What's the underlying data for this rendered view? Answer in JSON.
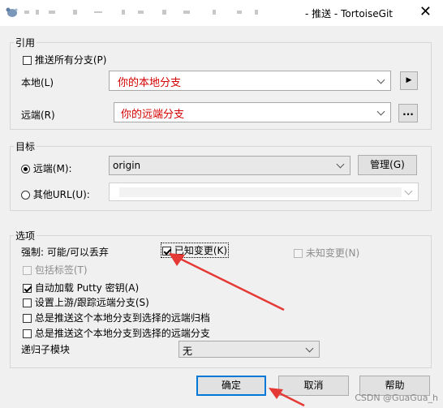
{
  "window": {
    "title": "- 推送 - TortoiseGit",
    "close_glyph": "✕"
  },
  "ref_group": {
    "legend": "引用",
    "push_all_label": "推送所有分支(P)",
    "local_label": "本地(L)",
    "local_value": "你的本地分支",
    "remote_label": "远端(R)",
    "remote_value": "你的远端分支",
    "browse_label": "...",
    "arrow_glyph": "▶"
  },
  "dest_group": {
    "legend": "目标",
    "remote_radio_label": "远端(M):",
    "remote_value": "origin",
    "manage_label": "管理(G)",
    "other_url_label": "其他URL(U):"
  },
  "options_group": {
    "legend": "选项",
    "force_label": "强制: 可能/可以丢弃",
    "known_changes_label": "已知变更(K)",
    "unknown_changes_label": "未知变更(N)",
    "include_tags_label": "包括标签(T)",
    "autoload_putty_label": "自动加载 Putty 密钥(A)",
    "set_upstream_label": "设置上游/跟踪远端分支(S)",
    "push_archive_label": "总是推送这个本地分支到选择的远端归档",
    "push_branch_label": "总是推送这个本地分支到选择的远端分支",
    "recurse_label": "递归子模块",
    "recurse_value": "无"
  },
  "buttons": {
    "ok": "确定",
    "cancel": "取消",
    "help": "帮助"
  },
  "watermark": "CSDN @GuaGua_h",
  "colors": {
    "accent": "#0078d7",
    "annotation": "#e53935",
    "value_text": "#d40000"
  }
}
